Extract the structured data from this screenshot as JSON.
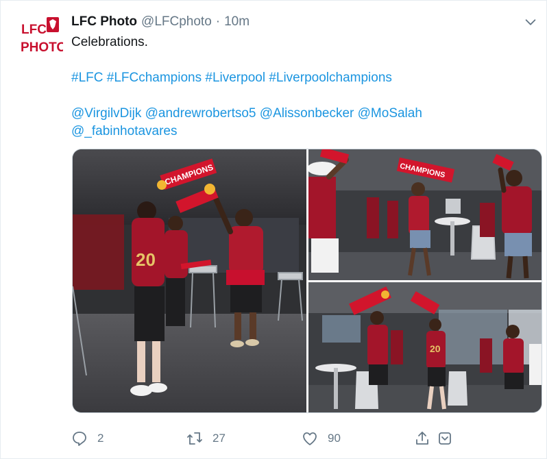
{
  "tweet": {
    "author_name": "LFC Photo",
    "author_handle": "@LFCphoto",
    "separator": "·",
    "time": "10m",
    "avatar_text_top": "LFC",
    "avatar_text_bottom": "PHOTO",
    "text": "Celebrations.",
    "hashtags": [
      "#LFC",
      "#LFCchampions",
      "#Liverpool",
      "#Liverpoolchampions"
    ],
    "mentions_line1": [
      "@VirgilvDijk",
      "@andrewrobertso5",
      "@Alissonbecker",
      "@MoSalah"
    ],
    "mentions_line2": [
      "@_fabinhotavares"
    ]
  },
  "media": {
    "photo1": {
      "scarf_text": "CHAMPIONS",
      "jersey_number": "20"
    },
    "photo2": {
      "scarf_text": "CHAMPIONS"
    },
    "photo3": {
      "jersey_number": "20"
    }
  },
  "actions": {
    "reply_count": "2",
    "retweet_count": "27",
    "like_count": "90"
  },
  "colors": {
    "link": "#1b95e0",
    "secondary_text": "#657786",
    "lfc_red": "#c8102e"
  },
  "icons": [
    "caret-down-icon",
    "reply-icon",
    "retweet-icon",
    "like-icon",
    "share-icon",
    "bookmark-icon"
  ]
}
